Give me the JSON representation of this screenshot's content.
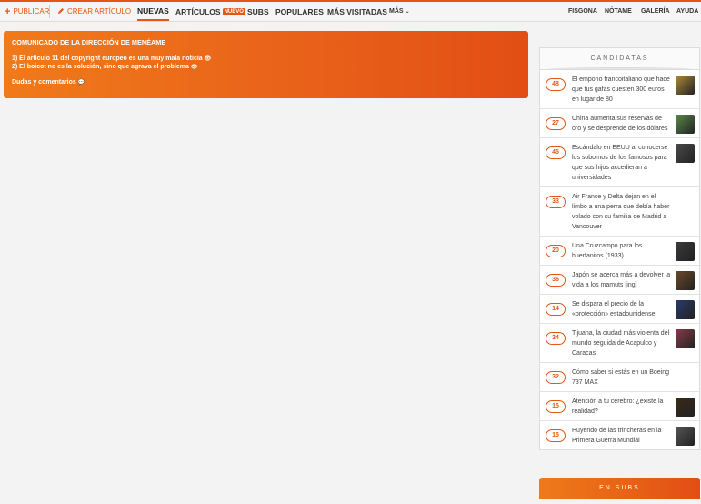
{
  "topbar": {
    "publish_label": "PUBLICAR",
    "create_label": "CREAR ARTÍCULO",
    "nav": [
      "NUEVAS",
      "ARTÍCULOS",
      "SUBS",
      "POPULARES",
      "MÁS VISITADAS",
      "MÁS"
    ],
    "articles_badge": "NUEVO",
    "right": [
      "FISGONA",
      "NÓTAME",
      "GALERÍA",
      "AYUDA"
    ]
  },
  "announcement": {
    "title": "COMUNICADO DE LA DIRECCIÓN DE MENÉAME",
    "lines": [
      "1) El artículo 11 del copyright europeo es una muy mala noticia",
      "2) El boicot no es la solución, sino que agrava el problema"
    ],
    "doubts": "Dudas y comentarios"
  },
  "sidebar": {
    "candidates_title": "CANDIDATAS",
    "items": [
      {
        "votes": "48",
        "text": "El emporio francoitaliano que hace que tus gafas cuesten 300 euros en lugar de 80",
        "thumb_color": "#b08a3a"
      },
      {
        "votes": "27",
        "text": "China aumenta sus reservas de oro y se desprende de los dólares",
        "thumb_color": "#5a8a4a"
      },
      {
        "votes": "45",
        "text": "Escándalo en EEUU al conocerse los sobornos de los famosos para que sus hijos accedieran a universidades",
        "thumb_color": "#4a4a4a"
      },
      {
        "votes": "33",
        "text": "Air France y Delta dejan en el limbo a una perra que debía haber volado con su familia de Madrid a Vancouver",
        "thumb_color": ""
      },
      {
        "votes": "20",
        "text": "Una Cruzcampo para los huerfanitos (1933)",
        "thumb_color": "#3a3a3a"
      },
      {
        "votes": "36",
        "text": "Japón se acerca más a devolver la vida a los mamuts [ing]",
        "thumb_color": "#6a4a2a"
      },
      {
        "votes": "14",
        "text": "Se dispara el precio de la «protección» estadounidense",
        "thumb_color": "#2a3a6a"
      },
      {
        "votes": "34",
        "text": "Tijuana, la ciudad más violenta del mundo seguida de Acapulco y Caracas",
        "thumb_color": "#8a3a4a"
      },
      {
        "votes": "32",
        "text": "Cómo saber si estás en un Boeing 737 MAX",
        "thumb_color": ""
      },
      {
        "votes": "15",
        "text": "Atención a tu cerebro: ¿existe la realidad?",
        "thumb_color": "#3a2a1a"
      },
      {
        "votes": "15",
        "text": "Huyendo de las trincheras en la Primera Guerra Mundial",
        "thumb_color": "#555555"
      }
    ],
    "subs_title": "EN SUBS"
  }
}
